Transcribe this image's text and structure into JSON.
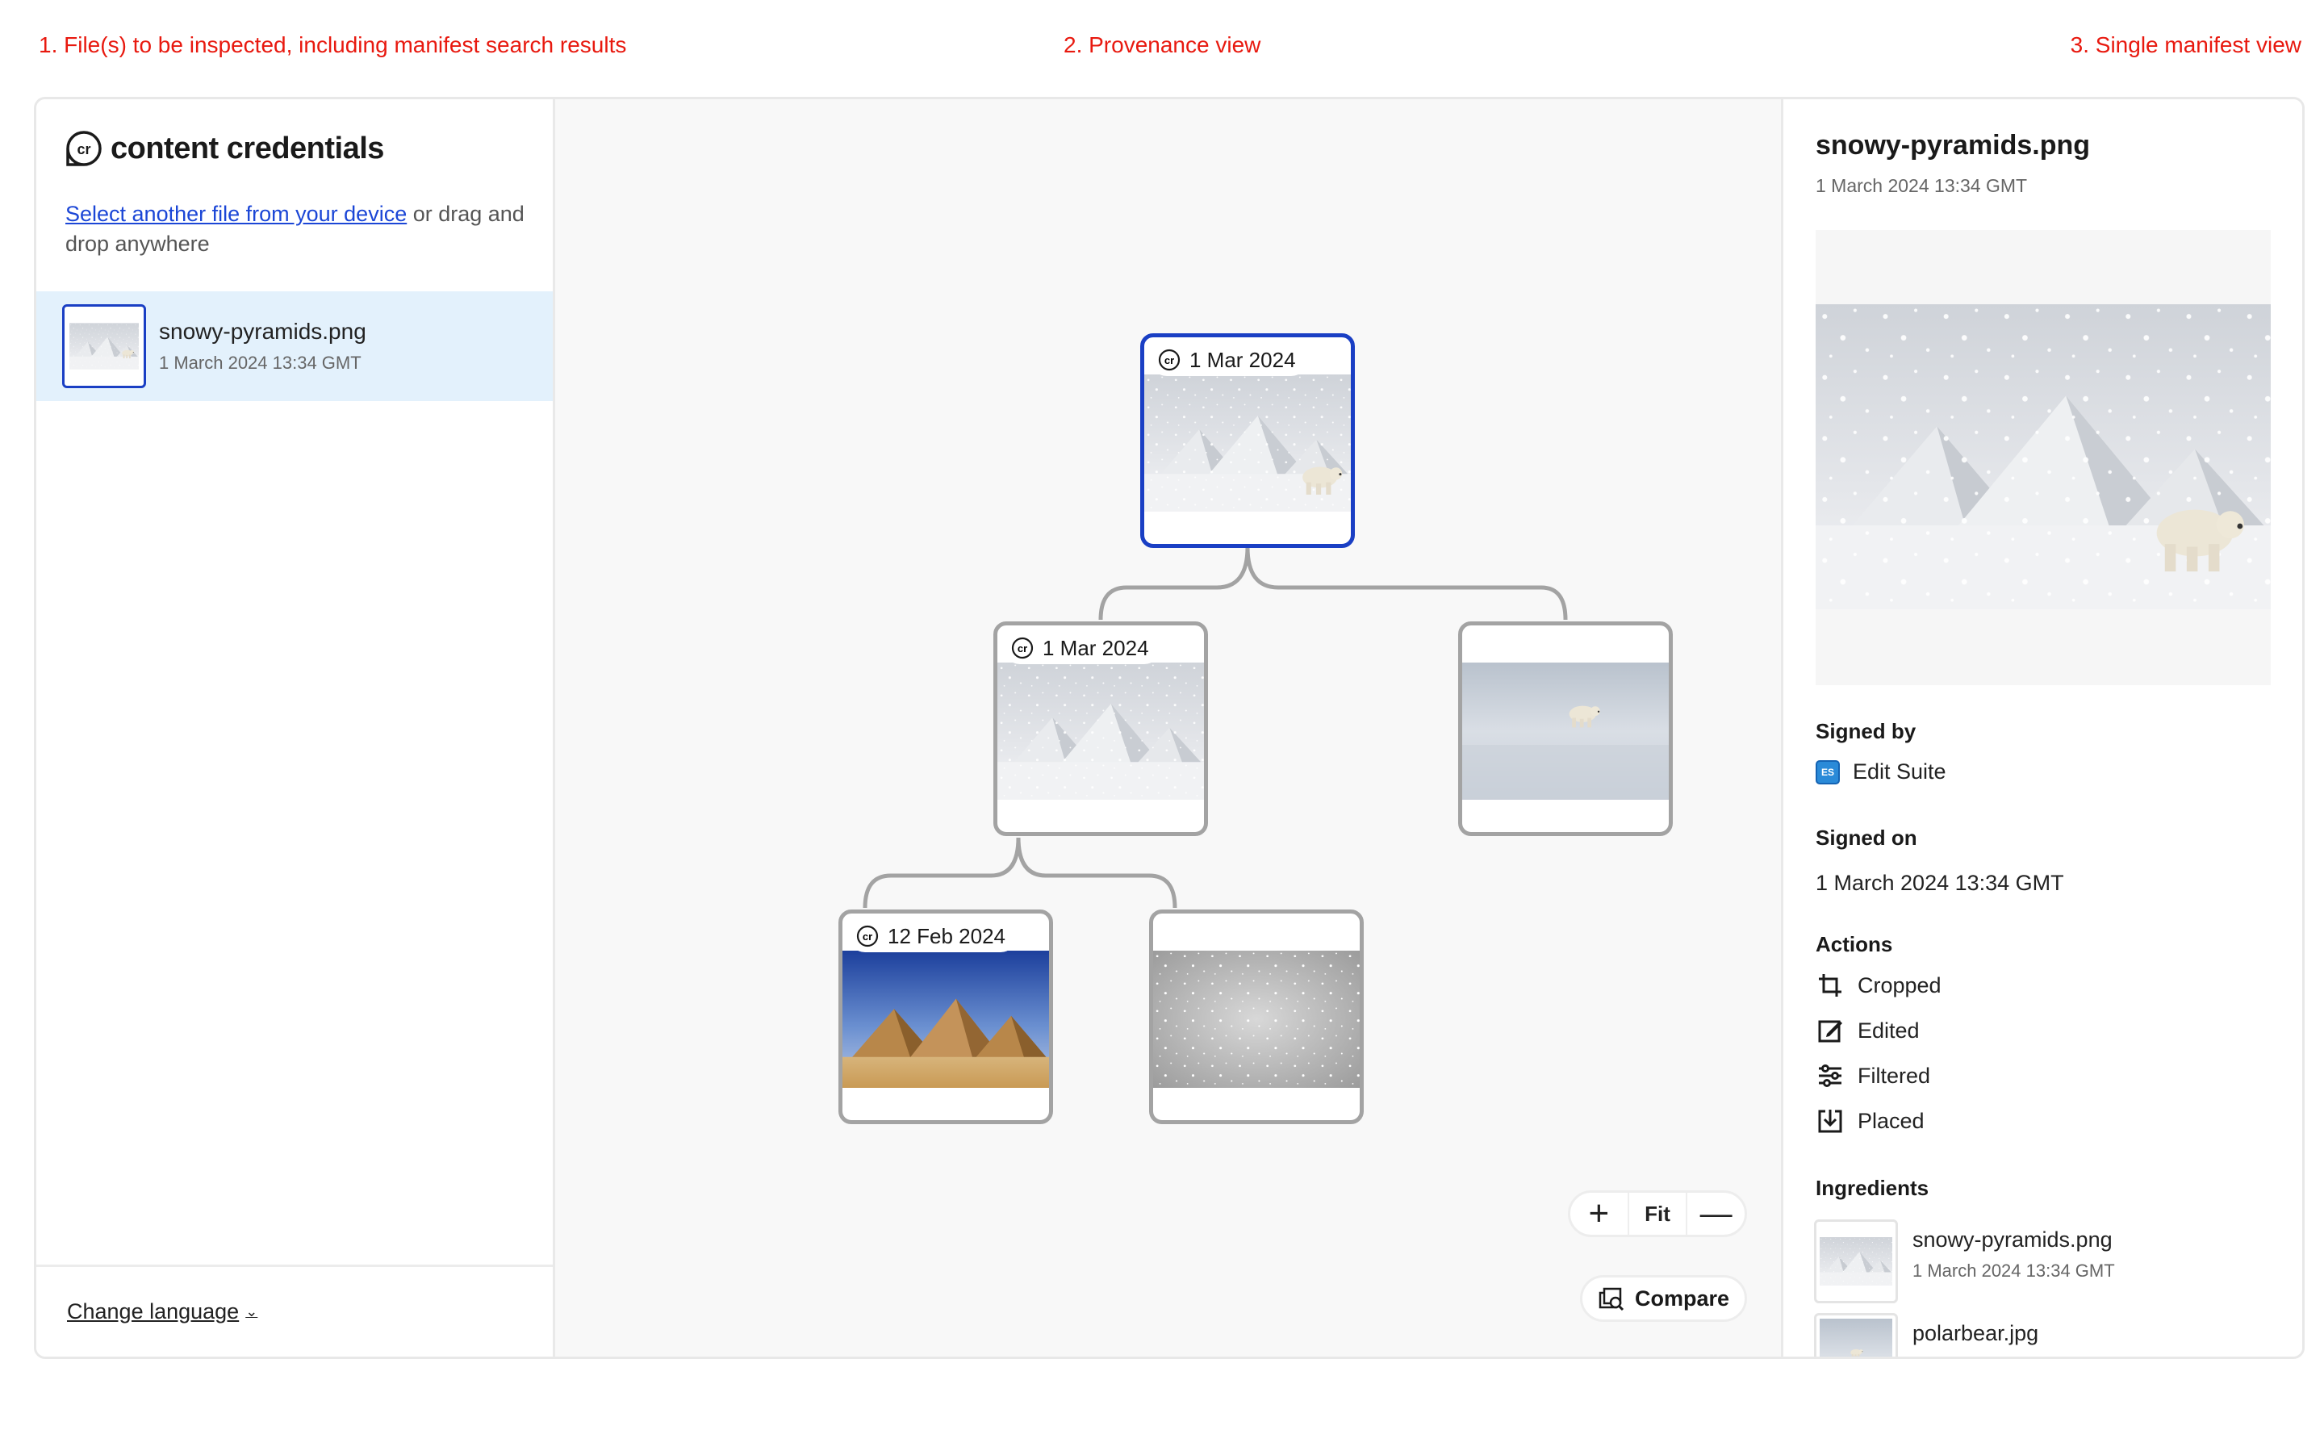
{
  "annotations": {
    "files": "1. File(s) to be inspected, including manifest search results",
    "provenance": "2. Provenance view",
    "single": "3. Single manifest view"
  },
  "left": {
    "brand_title": "content credentials",
    "select_link": "Select another file from your device",
    "select_rest": " or drag and drop anywhere",
    "file": {
      "name": "snowy-pyramids.png",
      "date": "1 March 2024 13:34 GMT"
    },
    "change_language": "Change language"
  },
  "tree": {
    "root": {
      "date": "1 Mar 2024",
      "image": "snowy-pyramids-polarbear"
    },
    "child1": {
      "date": "1 Mar 2024",
      "image": "snowy-pyramids"
    },
    "child2": {
      "image": "polarbear-on-ice"
    },
    "grand1": {
      "date": "12 Feb 2024",
      "image": "pyramids-desert"
    },
    "grand2": {
      "image": "snow-texture"
    }
  },
  "controls": {
    "zoom_in": "+",
    "fit": "Fit",
    "zoom_out": "—",
    "compare": "Compare"
  },
  "manifest": {
    "title": "snowy-pyramids.png",
    "date": "1 March 2024 13:34 GMT",
    "signed_by_label": "Signed by",
    "signed_by": "Edit Suite",
    "signed_on_label": "Signed on",
    "signed_on": "1 March 2024 13:34 GMT",
    "actions_label": "Actions",
    "actions": [
      "Cropped",
      "Edited",
      "Filtered",
      "Placed"
    ],
    "ingredients_label": "Ingredients",
    "ingredients": [
      {
        "name": "snowy-pyramids.png",
        "date": "1 March 2024 13:34 GMT"
      },
      {
        "name": "polarbear.jpg"
      }
    ]
  },
  "colors": {
    "accent": "#1a3fc4",
    "annotation": "#e8190f",
    "selected_row": "#e3f1fc",
    "link": "#1b46d6"
  }
}
